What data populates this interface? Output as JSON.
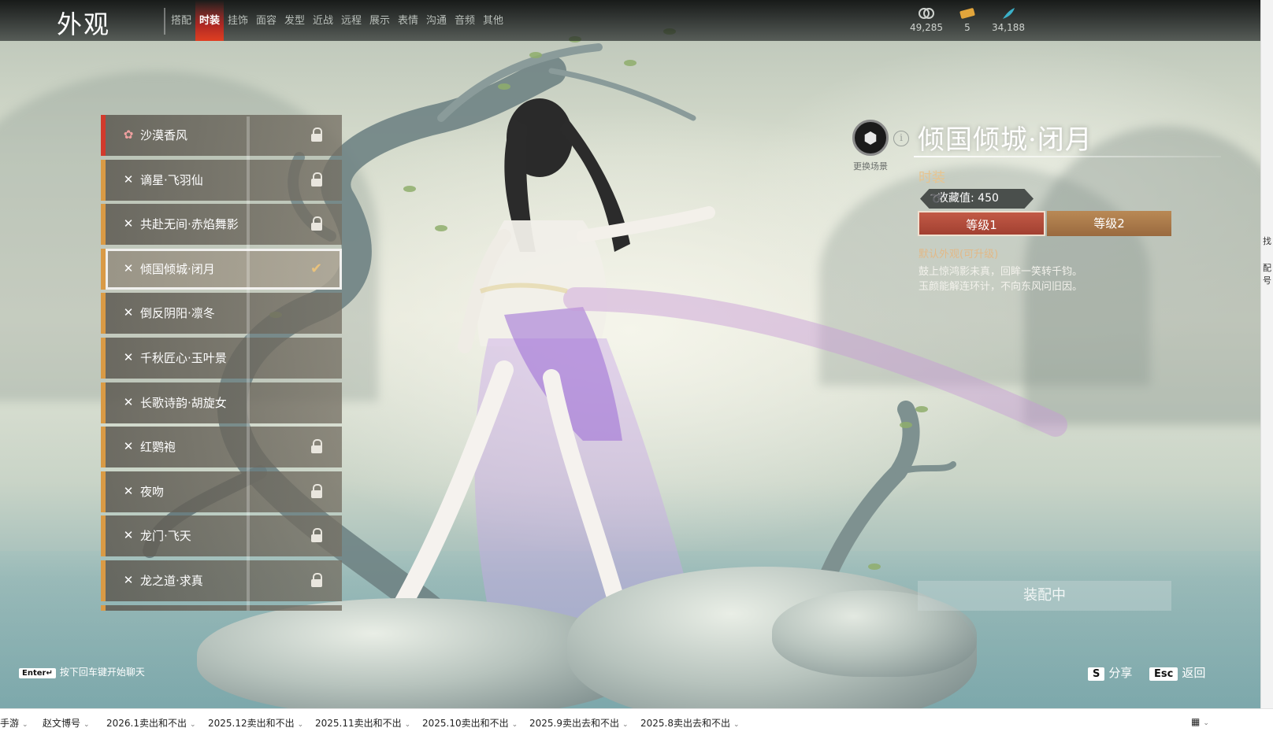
{
  "topbar": {
    "title": "外观",
    "tabs": [
      "搭配",
      "时装",
      "挂饰",
      "面容",
      "发型",
      "近战",
      "远程",
      "展示",
      "表情",
      "沟通",
      "音频",
      "其他"
    ],
    "active_tab": "时装",
    "currencies": [
      {
        "icon": "spiral-coin-icon",
        "value": "49,285"
      },
      {
        "icon": "ticket-icon",
        "value": "5"
      },
      {
        "icon": "feather-icon",
        "value": "34,188"
      }
    ]
  },
  "outfits": [
    {
      "name": "沙漠香风",
      "state": "locked"
    },
    {
      "name": "谪星·飞羽仙",
      "state": "locked"
    },
    {
      "name": "共赴无间·赤焰舞影",
      "state": "locked"
    },
    {
      "name": "倾国倾城·闭月",
      "state": "equipped"
    },
    {
      "name": "倒反阴阳·凛冬",
      "state": ""
    },
    {
      "name": "千秋匠心·玉叶景",
      "state": ""
    },
    {
      "name": "长歌诗韵·胡旋女",
      "state": ""
    },
    {
      "name": "红鹦袍",
      "state": "locked"
    },
    {
      "name": "夜吻",
      "state": "locked"
    },
    {
      "name": "龙门·飞天",
      "state": "locked"
    },
    {
      "name": "龙之道·求真",
      "state": "locked"
    }
  ],
  "detail": {
    "scene_label": "更换场景",
    "title": "倾国倾城·闭月",
    "category": "时装",
    "collect_label": "收藏值: 450",
    "levels": [
      "等级1",
      "等级2"
    ],
    "level_note": "默认外观(可升级)",
    "poem": [
      "鼓上惊鸿影未真，回眸一笑转千钧。",
      "玉颜能解连环计，不向东风问旧因。"
    ],
    "equip_label": "装配中"
  },
  "hints": {
    "enter_key": "Enter↵",
    "enter_text": "按下回车键开始聊天",
    "share_key": "S",
    "share_text": "分享",
    "back_key": "Esc",
    "back_text": "返回"
  },
  "taskbar": [
    "手游",
    "赵文博号",
    "2026.1卖出和不出",
    "2025.12卖出和不出",
    "2025.11卖出和不出",
    "2025.10卖出和不出",
    "2025.9卖出去和不出",
    "2025.8卖出去和不出"
  ],
  "sliver": [
    "找",
    "配号"
  ],
  "colors": {
    "active_tab": "#d21e19",
    "accent_gold": "#d99a45",
    "lock_red": "#d13a2c",
    "level_on": "#b34a39",
    "level_off": "#a8774a"
  }
}
